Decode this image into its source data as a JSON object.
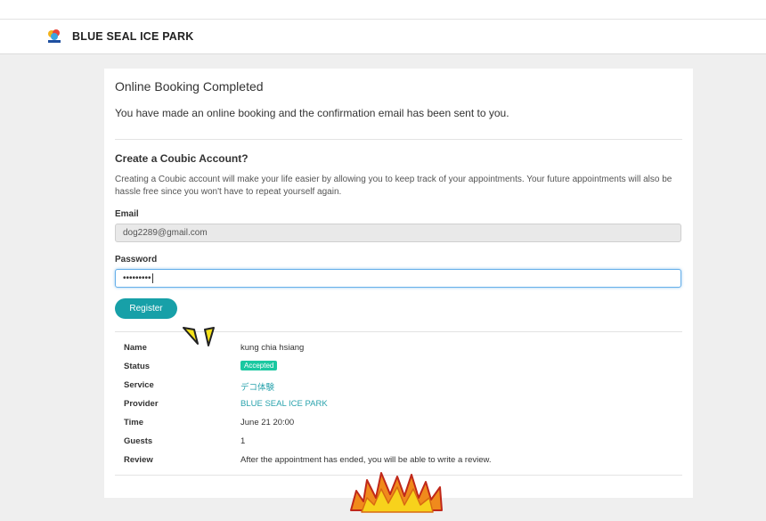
{
  "header": {
    "brand": "BLUE SEAL ICE PARK",
    "logo_icon": "blue-seal-logo"
  },
  "confirmation": {
    "title": "Online Booking Completed",
    "message": "You have made an online booking and the confirmation email has been sent to you."
  },
  "account": {
    "heading": "Create a Coubic Account?",
    "description": "Creating a Coubic account will make your life easier by allowing you to keep track of your appointments. Your future appointments will also be hassle free since you won't have to repeat yourself again.",
    "email_label": "Email",
    "email_value": "dog2289@gmail.com",
    "password_label": "Password",
    "password_value": "•••••••••",
    "register_label": "Register"
  },
  "details": {
    "name_label": "Name",
    "name_value": "kung chia hsiang",
    "status_label": "Status",
    "status_value": "Accepted",
    "service_label": "Service",
    "service_value": "デコ体験",
    "provider_label": "Provider",
    "provider_value": "BLUE SEAL ICE PARK",
    "time_label": "Time",
    "time_value": "June 21 20:00",
    "guests_label": "Guests",
    "guests_value": "1",
    "review_label": "Review",
    "review_value": "After the appointment has ended, you will be able to write a review."
  },
  "colors": {
    "accent": "#17a0a8",
    "status_badge": "#1bc8a1",
    "link": "#2aa3ad"
  }
}
